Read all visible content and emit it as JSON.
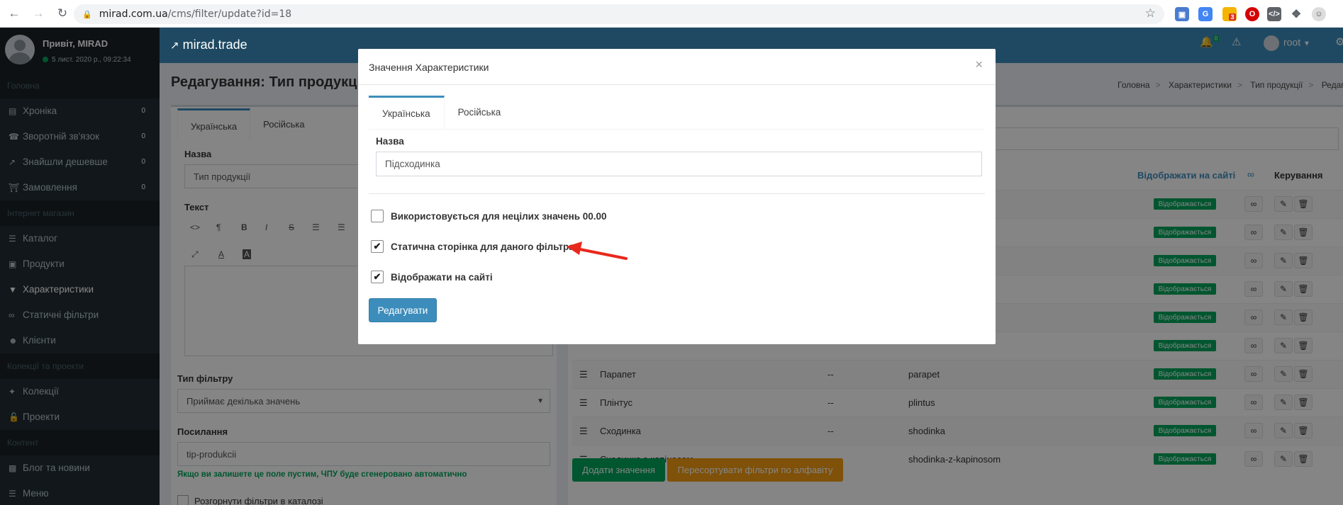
{
  "browser": {
    "url_host": "mirad.com.ua",
    "url_path": "/cms/filter/update?id=18",
    "ext_badge": "3"
  },
  "sidebar": {
    "user_name": "Привіт, MIRAD",
    "user_date": "5 лист. 2020 р., 09:22:34",
    "sections": [
      {
        "header": "Головна"
      },
      {
        "header": "Інтернет магазин"
      },
      {
        "header": "Колекції та проекти"
      },
      {
        "header": "Контент"
      }
    ],
    "items": [
      {
        "label": "Хроніка",
        "icon": "chart-icon",
        "count": "0"
      },
      {
        "label": "Зворотній зв'язок",
        "icon": "phone-icon",
        "count": "0"
      },
      {
        "label": "Знайшли дешевше",
        "icon": "external-link-icon",
        "count": "0"
      },
      {
        "label": "Замовлення",
        "icon": "bank-icon",
        "count": "0"
      },
      {
        "label": "Каталог",
        "icon": "list-icon"
      },
      {
        "label": "Продукти",
        "icon": "file-icon"
      },
      {
        "label": "Характеристики",
        "icon": "filter-icon"
      },
      {
        "label": "Статичні фільтри",
        "icon": "link-icon"
      },
      {
        "label": "Клієнти",
        "icon": "users-icon"
      },
      {
        "label": "Колекції",
        "icon": "wand-icon"
      },
      {
        "label": "Проекти",
        "icon": "unlock-icon"
      },
      {
        "label": "Блог та новини",
        "icon": "newspaper-icon"
      },
      {
        "label": "Меню",
        "icon": "menu-icon"
      }
    ]
  },
  "navbar": {
    "logo": "mirad.trade",
    "notif_count": "0",
    "user": "root"
  },
  "page": {
    "title": "Редагування: Тип продукції",
    "breadcrumb": [
      "Головна",
      "Характеристики",
      "Тип продукції",
      "Редагуват"
    ]
  },
  "left_form": {
    "tabs": [
      "Українська",
      "Російська"
    ],
    "name_label": "Назва",
    "name_value": "Тип продукції",
    "text_label": "Текст",
    "filter_type_label": "Тип фільтру",
    "filter_type_value": "Приймає декілька значень",
    "link_label": "Посилання",
    "link_value": "tip-produkcii",
    "link_hint": "Якщо ви залишете це поле пустим, ЧПУ буде сгенеровано автоматично",
    "expand_label": "Розгорнути фільтри в каталозі"
  },
  "table": {
    "headers": {
      "display": "Відображати на сайті",
      "manage": "Керування"
    },
    "badge_text": "Відображається",
    "rows": [
      {
        "name": "Парапет",
        "dash": "--",
        "slug": "parapet"
      },
      {
        "name": "Плінтус",
        "dash": "--",
        "slug": "plintus"
      },
      {
        "name": "Сходинка",
        "dash": "--",
        "slug": "shodinka"
      },
      {
        "name": "Сходинка з капіносом",
        "dash": "--",
        "slug": "shodinka-z-kapinosom"
      }
    ],
    "add_button": "Додати значення",
    "sort_button": "Пересортувати фільтри по алфавіту"
  },
  "modal": {
    "title": "Значення Характеристики",
    "close": "×",
    "tabs": [
      "Українська",
      "Російська"
    ],
    "name_label": "Назва",
    "name_value": "Підсходинка",
    "checkboxes": [
      {
        "label": "Використовується для нецілих значень 00.00",
        "checked": false
      },
      {
        "label": "Статична сторінка для даного фільтра",
        "checked": true
      },
      {
        "label": "Відображати на сайті",
        "checked": true
      }
    ],
    "submit": "Редагувати"
  },
  "colors": {
    "primary": "#3c8dbc",
    "success": "#00a65a",
    "warning": "#f39c12",
    "sidebar": "#222d32",
    "arrow": "#e8281c"
  }
}
